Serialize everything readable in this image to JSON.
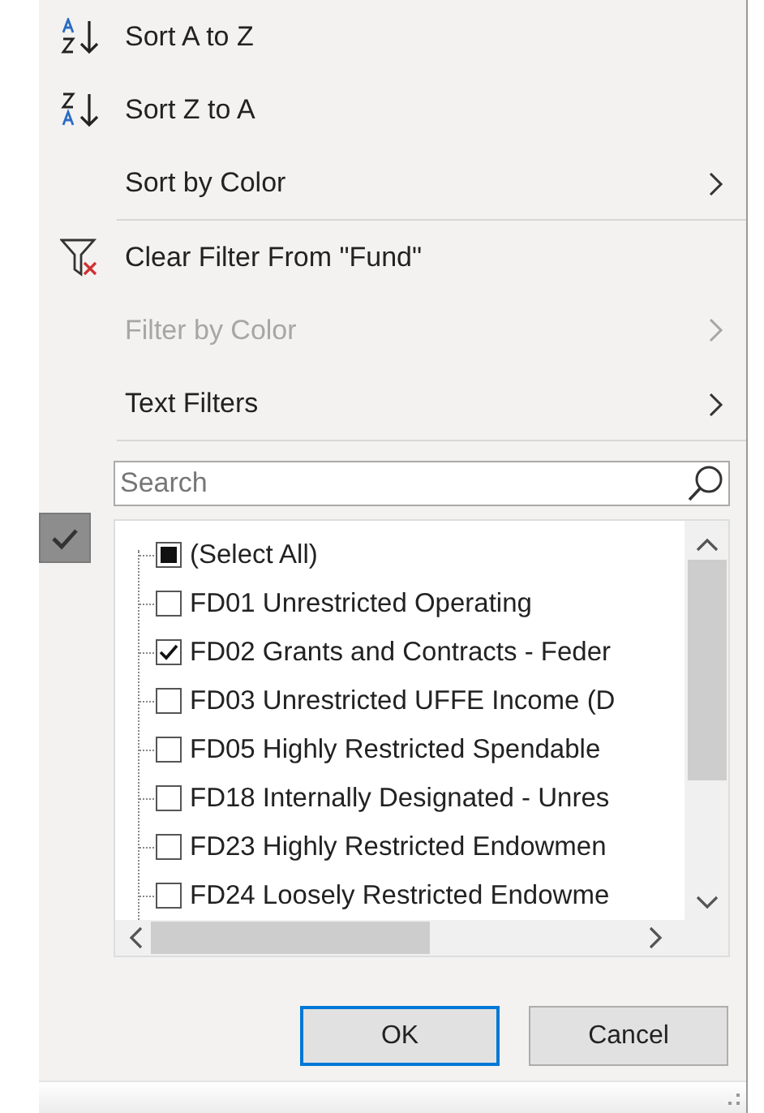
{
  "menu": [
    {
      "label": "Sort A to Z",
      "kind": "sort-az",
      "submenu": false,
      "disabled": false,
      "separator_after": false
    },
    {
      "label": "Sort Z to A",
      "kind": "sort-za",
      "submenu": false,
      "disabled": false,
      "separator_after": false
    },
    {
      "label": "Sort by Color",
      "kind": "plain",
      "submenu": true,
      "disabled": false,
      "separator_after": true
    },
    {
      "label": "Clear Filter From \"Fund\"",
      "kind": "clear-filter",
      "submenu": false,
      "disabled": false,
      "separator_after": false
    },
    {
      "label": "Filter by Color",
      "kind": "plain",
      "submenu": true,
      "disabled": true,
      "separator_after": false
    },
    {
      "label": "Text Filters",
      "kind": "plain",
      "submenu": true,
      "disabled": false,
      "separator_after": true
    }
  ],
  "filter_applied": true,
  "search": {
    "placeholder": "Search"
  },
  "select_all": {
    "label": "(Select All)",
    "indeterminate": true
  },
  "values": [
    {
      "label": "FD01 Unrestricted Operating",
      "checked": false
    },
    {
      "label": "FD02 Grants and Contracts - Feder",
      "checked": true
    },
    {
      "label": "FD03 Unrestricted UFFE Income (D",
      "checked": false
    },
    {
      "label": "FD05 Highly Restricted Spendable",
      "checked": false
    },
    {
      "label": "FD18 Internally Designated - Unres",
      "checked": false
    },
    {
      "label": "FD23 Highly Restricted Endowmen",
      "checked": false
    },
    {
      "label": "FD24 Loosely Restricted Endowme",
      "checked": false
    }
  ],
  "buttons": [
    {
      "label": "OK",
      "default": true
    },
    {
      "label": "Cancel",
      "default": false
    }
  ]
}
